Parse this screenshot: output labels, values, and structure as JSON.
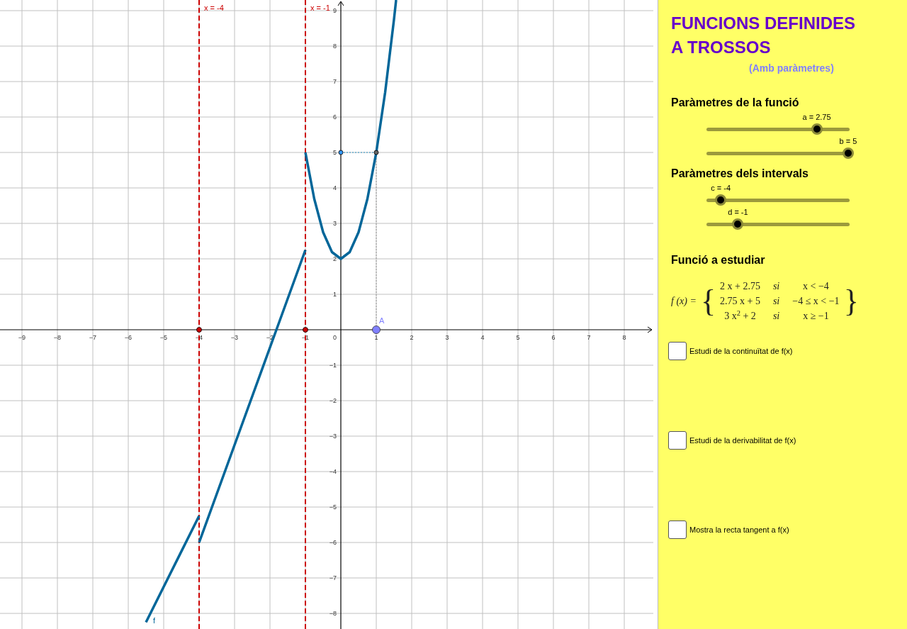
{
  "graph": {
    "chart_data": {
      "type": "line",
      "x": [
        -5.5,
        -4.8,
        -4,
        -4,
        -3,
        -2,
        -1,
        -1,
        -0.75,
        -0.5,
        -0.25,
        0,
        0.25,
        0.5,
        0.75,
        1,
        1.25,
        1.5,
        1.56
      ],
      "series": [
        {
          "name": "f",
          "color": "#006699",
          "values": [
            -8.25,
            -6.85,
            -5.25,
            -6,
            -3.25,
            -0.5,
            2.25,
            5,
            3.69,
            2.75,
            2.19,
            2,
            2.19,
            2.75,
            3.69,
            5,
            6.69,
            8.75,
            9.3
          ]
        }
      ],
      "grid": true,
      "xlim": [
        -9.62,
        8.82
      ],
      "ylim": [
        -8.44,
        9.3
      ],
      "xticks": [
        {
          "value": -9,
          "label": "−9"
        },
        {
          "value": -8,
          "label": "−8"
        },
        {
          "value": -7,
          "label": "−7"
        },
        {
          "value": -6,
          "label": "−6"
        },
        {
          "value": -5,
          "label": "−5"
        },
        {
          "value": -4,
          "label": "−4"
        },
        {
          "value": -3,
          "label": "−3"
        },
        {
          "value": -2,
          "label": "−2"
        },
        {
          "value": -1,
          "label": "−1"
        },
        {
          "value": 1,
          "label": "1"
        },
        {
          "value": 2,
          "label": "2"
        },
        {
          "value": 3,
          "label": "3"
        },
        {
          "value": 4,
          "label": "4"
        },
        {
          "value": 5,
          "label": "5"
        },
        {
          "value": 6,
          "label": "6"
        },
        {
          "value": 7,
          "label": "7"
        },
        {
          "value": 8,
          "label": "8"
        }
      ],
      "yticks": [
        {
          "value": -8,
          "label": "−8"
        },
        {
          "value": -7,
          "label": "−7"
        },
        {
          "value": -6,
          "label": "−6"
        },
        {
          "value": -5,
          "label": "−5"
        },
        {
          "value": -4,
          "label": "−4"
        },
        {
          "value": -3,
          "label": "−3"
        },
        {
          "value": -2,
          "label": "−2"
        },
        {
          "value": -1,
          "label": "−1"
        },
        {
          "value": 1,
          "label": "1"
        },
        {
          "value": 2,
          "label": "2"
        },
        {
          "value": 3,
          "label": "3"
        },
        {
          "value": 4,
          "label": "4"
        },
        {
          "value": 5,
          "label": "5"
        },
        {
          "value": 6,
          "label": "6"
        },
        {
          "value": 7,
          "label": "7"
        },
        {
          "value": 8,
          "label": "8"
        },
        {
          "value": 9,
          "label": "9"
        }
      ]
    },
    "origin_label": "0",
    "asymptotes": [
      {
        "label": "x = -4"
      },
      {
        "label": "x = -1"
      }
    ],
    "point": {
      "label": "A"
    }
  },
  "panel": {
    "title_lines": [
      "FUNCIONS DEFINIDES",
      "A TROSSOS"
    ],
    "subtitle": "(Amb paràmetres)",
    "groups": [
      {
        "heading": "Paràmetres de la funció",
        "sliders": [
          {
            "label": "a = 2.75",
            "level": 0.77
          },
          {
            "label": "b = 5",
            "level": 0.99
          }
        ]
      },
      {
        "heading": "Paràmetres dels intervals",
        "sliders": [
          {
            "label": "c = -4",
            "level": 0.1
          },
          {
            "label": "d = -1",
            "level": 0.22
          }
        ]
      }
    ],
    "function_heading": "Funció a estudiar",
    "formula": {
      "lhs": "f (x) =",
      "open": "{",
      "close": "}",
      "rows": [
        {
          "expr": "2 x + 2.75",
          "word": "si",
          "cond": "x < −4"
        },
        {
          "expr": "2.75 x + 5",
          "word": "si",
          "cond": "−4 ≤ x < −1"
        },
        {
          "expr": "3 x$^{2}$ + 2",
          "word": "si",
          "cond": "x ≥ −1"
        }
      ]
    },
    "checkboxes": [
      {
        "label": "Estudi de la continuïtat de f(x)",
        "checked": false
      },
      {
        "label": "Estudi de la derivabilitat de f(x)",
        "checked": false
      },
      {
        "label": "Mostra la recta tangent a f(x)",
        "checked": false
      }
    ]
  }
}
